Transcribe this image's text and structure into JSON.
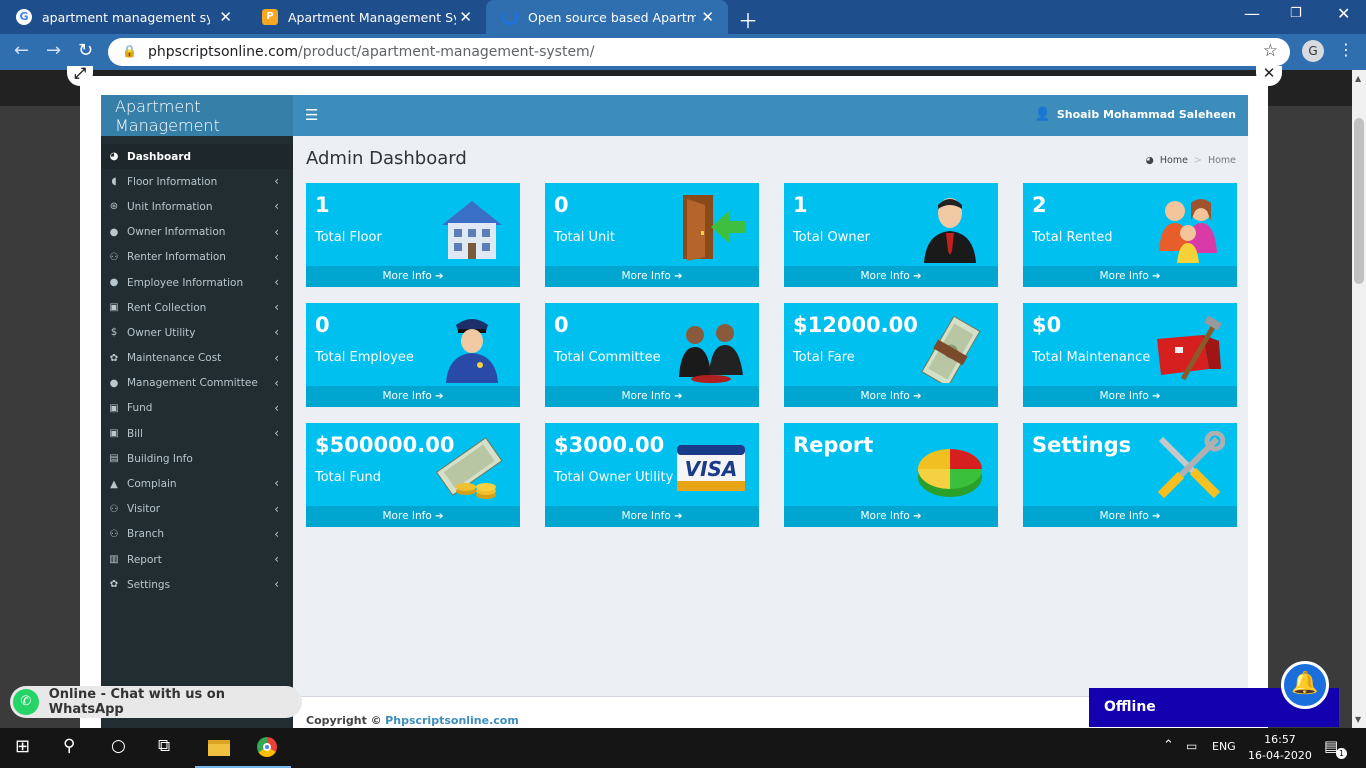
{
  "browser": {
    "tabs": [
      {
        "title": "apartment management system |",
        "favicon": "google-icon",
        "color": "#4285f4"
      },
      {
        "title": "Apartment Management System",
        "favicon": "product-icon",
        "color": "#f5a623"
      },
      {
        "title": "Open source based Apartment M",
        "favicon": "loading-icon",
        "color": "#1a73e8"
      }
    ],
    "url_host": "phpscriptsonline.com",
    "url_path": "/product/apartment-management-system/",
    "profile_initial": "G"
  },
  "app": {
    "brand": "Apartment Management",
    "user_name": "Shoaib Mohammad Saleheen",
    "page_title": "Admin Dashboard",
    "breadcrumb": [
      "Home",
      "Home"
    ],
    "sidebar": [
      {
        "label": "Dashboard",
        "icon": "dashboard-icon",
        "active": true
      },
      {
        "label": "Floor Information",
        "icon": "floor-icon"
      },
      {
        "label": "Unit Information",
        "icon": "unit-icon"
      },
      {
        "label": "Owner Information",
        "icon": "owner-icon"
      },
      {
        "label": "Renter Information",
        "icon": "renter-icon"
      },
      {
        "label": "Employee Information",
        "icon": "employee-icon"
      },
      {
        "label": "Rent Collection",
        "icon": "rent-icon"
      },
      {
        "label": "Owner Utility",
        "icon": "dollar-icon"
      },
      {
        "label": "Maintenance Cost",
        "icon": "gear-icon"
      },
      {
        "label": "Management Committee",
        "icon": "committee-icon"
      },
      {
        "label": "Fund",
        "icon": "fund-icon"
      },
      {
        "label": "Bill",
        "icon": "bill-icon"
      },
      {
        "label": "Building Info",
        "icon": "building-icon"
      },
      {
        "label": "Complain",
        "icon": "warning-icon"
      },
      {
        "label": "Visitor",
        "icon": "visitor-icon"
      },
      {
        "label": "Branch",
        "icon": "branch-icon"
      },
      {
        "label": "Report",
        "icon": "report-icon"
      },
      {
        "label": "Settings",
        "icon": "settings-icon"
      }
    ],
    "boxes": [
      {
        "value": "1",
        "label": "Total Floor",
        "more": "More Info",
        "art": "building-art"
      },
      {
        "value": "0",
        "label": "Total Unit",
        "more": "More Info",
        "art": "door-art"
      },
      {
        "value": "1",
        "label": "Total Owner",
        "more": "More Info",
        "art": "owner-art"
      },
      {
        "value": "2",
        "label": "Total Rented",
        "more": "More Info",
        "art": "family-art"
      },
      {
        "value": "0",
        "label": "Total Employee",
        "more": "More Info",
        "art": "police-art"
      },
      {
        "value": "0",
        "label": "Total Committee",
        "more": "More Info",
        "art": "committee-art"
      },
      {
        "value": "$12000.00",
        "label": "Total Fare",
        "more": "More Info",
        "art": "money-art"
      },
      {
        "value": "$0",
        "label": "Total Maintenance",
        "more": "More Info",
        "art": "toolbox-art"
      },
      {
        "value": "$500000.00",
        "label": "Total Fund",
        "more": "More Info",
        "art": "fund-art"
      },
      {
        "value": "$3000.00",
        "label": "Total Owner Utility",
        "more": "More Info",
        "art": "visa-art"
      },
      {
        "value": "Report",
        "label": "",
        "more": "More Info",
        "art": "pie-art"
      },
      {
        "value": "Settings",
        "label": "",
        "more": "More Info",
        "art": "tools-art"
      }
    ],
    "footer_prefix": "Copyright ©",
    "footer_link": "Phpscriptsonline.com",
    "visa_text": "VISA"
  },
  "widgets": {
    "whatsapp": "Online - Chat with us on WhatsApp",
    "offline": "Offline"
  },
  "taskbar": {
    "lang": "ENG",
    "time": "16:57",
    "date": "16-04-2020",
    "notifications": "1"
  }
}
